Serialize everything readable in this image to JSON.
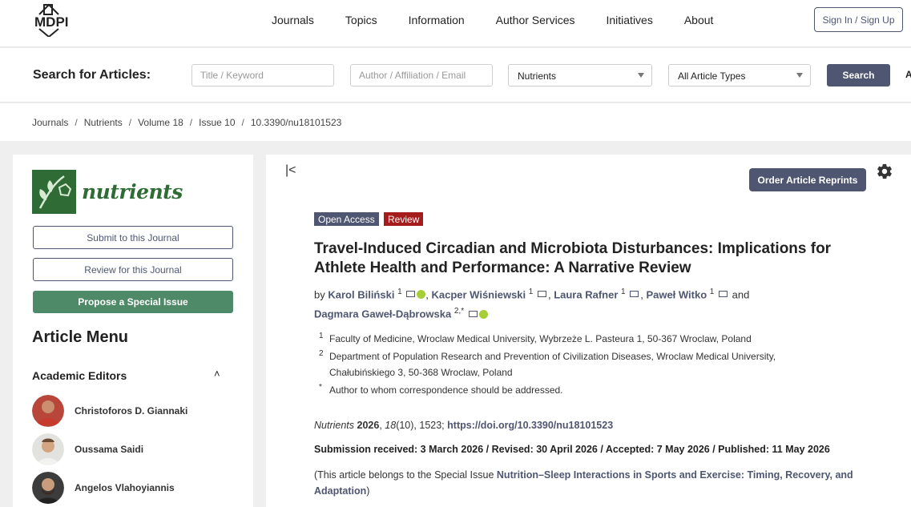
{
  "header": {
    "logo_text": "MDPI",
    "nav": [
      "Journals",
      "Topics",
      "Information",
      "Author Services",
      "Initiatives",
      "About"
    ],
    "sign_in": "Sign In / Sign Up"
  },
  "search": {
    "label": "Search for Articles:",
    "keyword_placeholder": "Title / Keyword",
    "author_placeholder": "Author / Affiliation / Email",
    "journal_value": "Nutrients",
    "type_value": "All Article Types",
    "button": "Search",
    "advanced_cut": "A"
  },
  "breadcrumb": [
    "Journals",
    "Nutrients",
    "Volume 18",
    "Issue 10",
    "10.3390/nu18101523"
  ],
  "sidebar": {
    "journal_name": "nutrients",
    "submit": "Submit to this Journal",
    "review": "Review for this Journal",
    "propose": "Propose a Special Issue",
    "menu_title": "Article Menu",
    "editors_heading": "Academic Editors",
    "editors": [
      "Christoforos D. Giannaki",
      "Oussama Saidi",
      "Angelos Vlahoyiannis"
    ]
  },
  "article": {
    "reprints": "Order Article Reprints",
    "badge_open": "Open Access",
    "badge_type": "Review",
    "title": "Travel-Induced Circadian and Microbiota Disturbances: Implications for Athlete Health and Performance: A Narrative Review",
    "by": "by",
    "authors": [
      {
        "name": "Karol Biliński",
        "sup": "1"
      },
      {
        "name": "Kacper Wiśniewski",
        "sup": "1"
      },
      {
        "name": "Laura Rafner",
        "sup": "1"
      },
      {
        "name": "Paweł Witko",
        "sup": "1"
      },
      {
        "name": "Dagmara Gaweł-Dąbrowska",
        "sup": "2,*"
      }
    ],
    "and": "and",
    "affiliations": [
      {
        "num": "1",
        "text": "Faculty of Medicine, Wroclaw Medical University, Wybrzeże L. Pasteura 1, 50-367 Wroclaw, Poland"
      },
      {
        "num": "2",
        "text": "Department of Population Research and Prevention of Civilization Diseases, Wroclaw Medical University, Chałubińskiego 3, 50-368 Wroclaw, Poland"
      },
      {
        "num": "*",
        "text": "Author to whom correspondence should be addressed."
      }
    ],
    "citation_journal": "Nutrients",
    "citation_year": "2026",
    "citation_volume": "18",
    "citation_rest": "(10), 1523;",
    "doi": "https://doi.org/10.3390/nu18101523",
    "dates": "Submission received: 3 March 2026 / Revised: 30 April 2026 / Accepted: 7 May 2026 / Published: 11 May 2026",
    "special_prefix": "(This article belongs to the Special Issue",
    "special_link": "Nutrition–Sleep Interactions in Sports and Exercise: Timing, Recovery, and Adaptation",
    "special_suffix": ")"
  },
  "colors": {
    "brand": "#4f5671",
    "journal_green": "#2f6b34",
    "propose_green": "#4f8a68",
    "review_red": "#a61c1c"
  }
}
